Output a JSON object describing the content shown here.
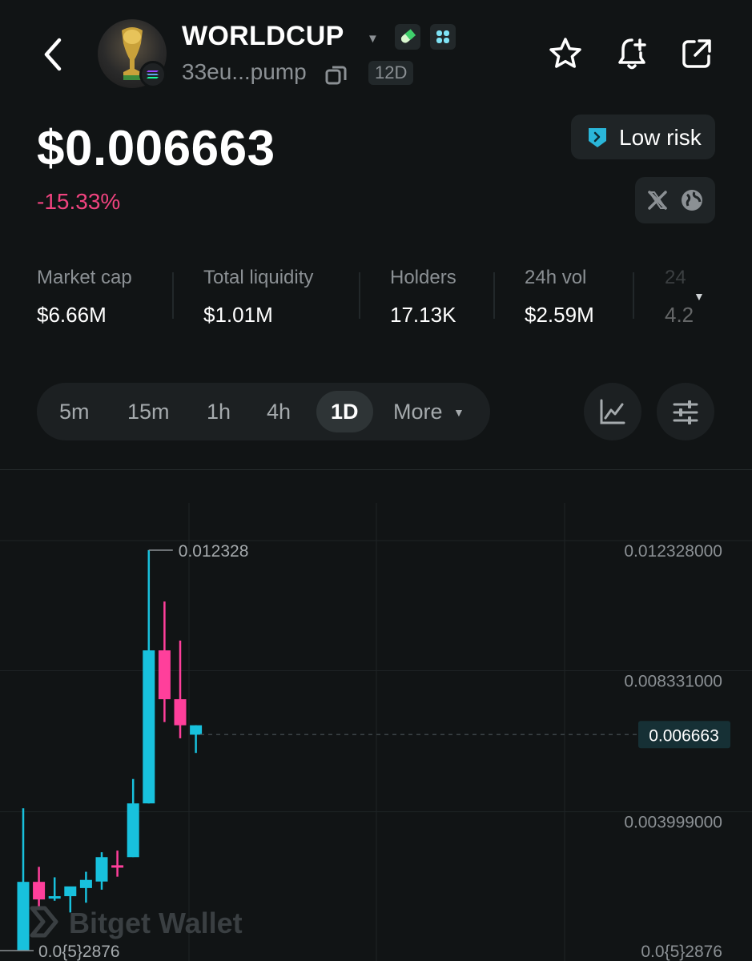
{
  "header": {
    "token_name": "WORLDCUP",
    "address": "33eu...pump",
    "age": "12D",
    "icons": [
      "back-arrow-icon",
      "trophy-avatar",
      "solana-chain-icon",
      "dropdown-caret-icon",
      "pill-tag-icon",
      "apps-tag-icon",
      "copy-icon",
      "star-icon",
      "bell-plus-icon",
      "share-icon"
    ]
  },
  "price": {
    "value": "$0.006663",
    "change": "-15.33%"
  },
  "risk": {
    "label": "Low risk"
  },
  "social": {
    "icons": [
      "x-icon",
      "globe-icon"
    ]
  },
  "stats": [
    {
      "label": "Market cap",
      "value": "$6.66M"
    },
    {
      "label": "Total liquidity",
      "value": "$1.01M"
    },
    {
      "label": "Holders",
      "value": "17.13K"
    },
    {
      "label": "24h vol",
      "value": "$2.59M"
    },
    {
      "label": "24",
      "value": "4.2"
    }
  ],
  "timeframes": {
    "items": [
      "5m",
      "15m",
      "1h",
      "4h",
      "1D"
    ],
    "more": "More",
    "active": "1D"
  },
  "colors": {
    "up": "#18c1dd",
    "down": "#ff3f9b",
    "negative": "#f0437f",
    "background": "#111415"
  },
  "chart_data": {
    "type": "candlestick",
    "y_labels": [
      "0.012328000",
      "0.008331000",
      "0.003999000",
      "0.0{5}2876"
    ],
    "y_label_values": [
      0.012328,
      0.008331,
      0.003999,
      2.876e-05
    ],
    "high_marker": "0.012328",
    "low_marker": "0.0{5}2876",
    "current_price": "0.006663",
    "watermark": "Bitget Wallet",
    "candles": [
      {
        "o": 2.876e-05,
        "h": 0.0044,
        "l": 2.876e-05,
        "c": 0.00214,
        "dir": "up"
      },
      {
        "o": 0.00214,
        "h": 0.0026,
        "l": 0.00132,
        "c": 0.0016,
        "dir": "down"
      },
      {
        "o": 0.00165,
        "h": 0.00228,
        "l": 0.00156,
        "c": 0.0017,
        "dir": "up"
      },
      {
        "o": 0.0017,
        "h": 0.0019,
        "l": 0.0012,
        "c": 0.002,
        "dir": "up"
      },
      {
        "o": 0.00195,
        "h": 0.00245,
        "l": 0.0015,
        "c": 0.0022,
        "dir": "up"
      },
      {
        "o": 0.00215,
        "h": 0.00305,
        "l": 0.0019,
        "c": 0.0029,
        "dir": "up"
      },
      {
        "o": 0.00265,
        "h": 0.0031,
        "l": 0.0023,
        "c": 0.00265,
        "dir": "down"
      },
      {
        "o": 0.0029,
        "h": 0.0053,
        "l": 0.0029,
        "c": 0.00455,
        "dir": "up"
      },
      {
        "o": 0.00455,
        "h": 0.01233,
        "l": 0.00455,
        "c": 0.00925,
        "dir": "up"
      },
      {
        "o": 0.00925,
        "h": 0.01075,
        "l": 0.00705,
        "c": 0.00775,
        "dir": "down"
      },
      {
        "o": 0.00775,
        "h": 0.00955,
        "l": 0.00655,
        "c": 0.00695,
        "dir": "down"
      },
      {
        "o": 0.00695,
        "h": 0.00695,
        "l": 0.0061,
        "c": 0.00666,
        "dir": "up"
      }
    ]
  }
}
